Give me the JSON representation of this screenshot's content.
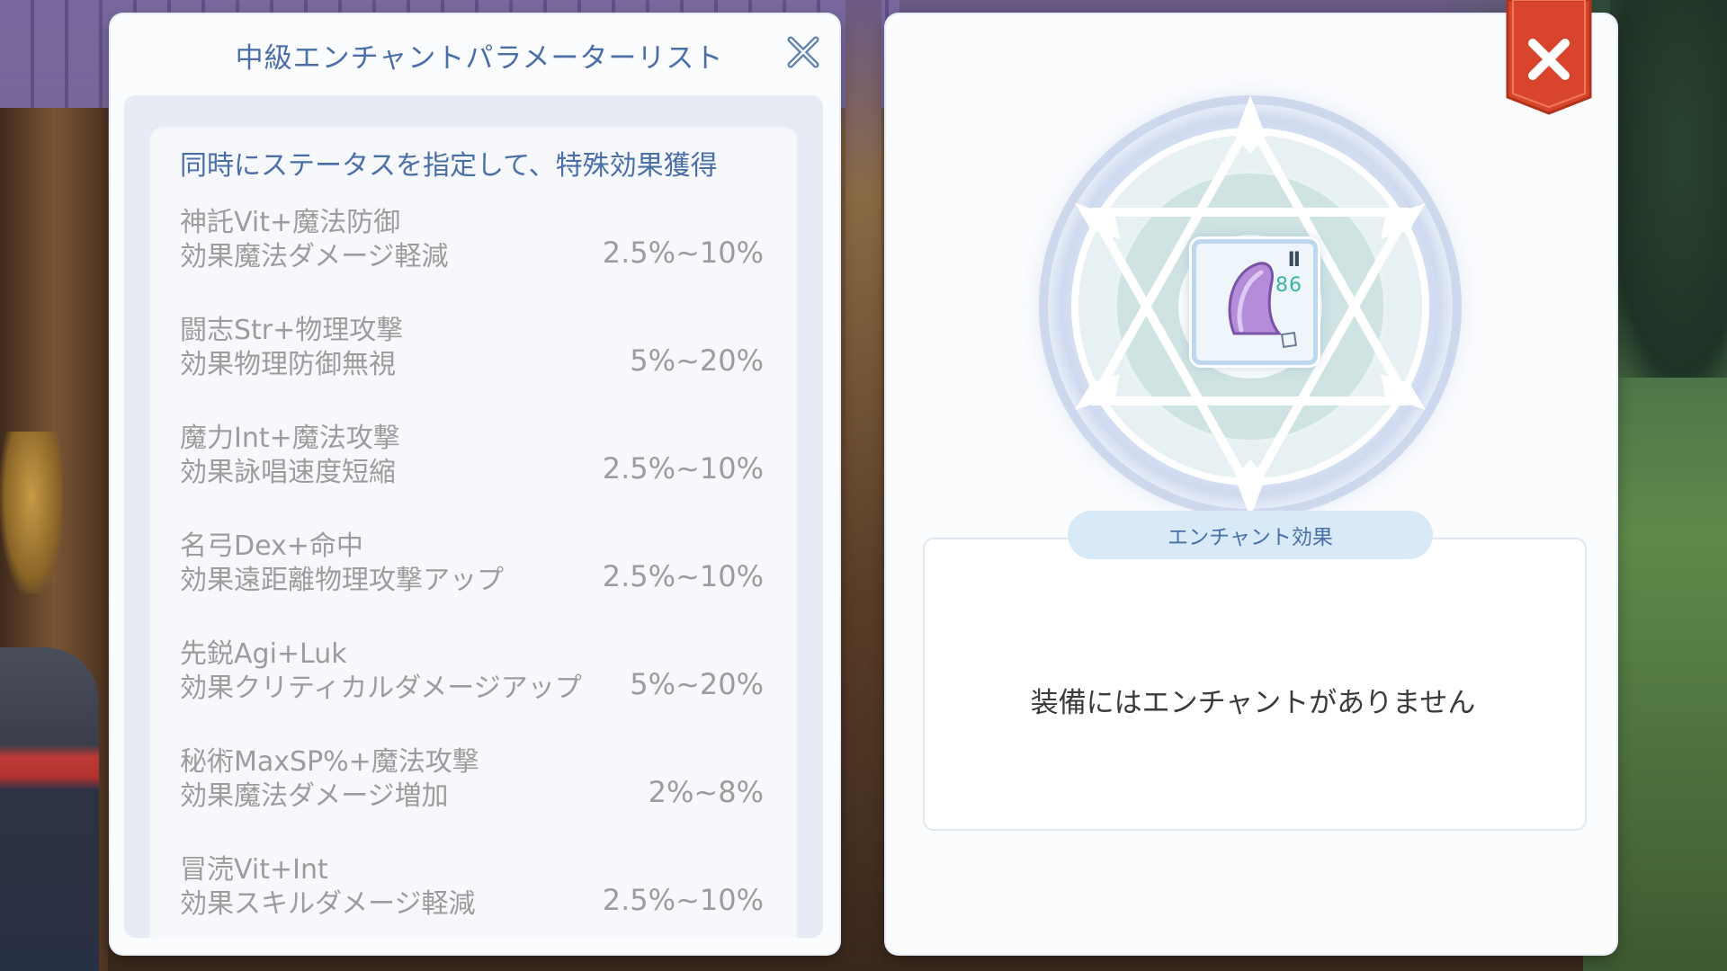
{
  "left_panel": {
    "title": "中級エンチャントパラメーターリスト",
    "heading": "同時にステータスを指定して、特殊効果獲得",
    "entries": [
      {
        "line1": "神託Vit+魔法防御",
        "line2": "効果魔法ダメージ軽減",
        "range": "2.5%~10%"
      },
      {
        "line1": "闘志Str+物理攻撃",
        "line2": "効果物理防御無視",
        "range": "5%~20%"
      },
      {
        "line1": "魔力Int+魔法攻撃",
        "line2": "効果詠唱速度短縮",
        "range": "2.5%~10%"
      },
      {
        "line1": "名弓Dex+命中",
        "line2": "効果遠距離物理攻撃アップ",
        "range": "2.5%~10%"
      },
      {
        "line1": "先鋭Agi+Luk",
        "line2": "効果クリティカルダメージアップ",
        "range": "5%~20%"
      },
      {
        "line1": "秘術MaxSP%+魔法攻撃",
        "line2": "効果魔法ダメージ増加",
        "range": "2%~8%"
      },
      {
        "line1": "冒涜Vit+Int",
        "line2": "効果スキルダメージ軽減",
        "range": "2.5%~10%"
      }
    ]
  },
  "right_panel": {
    "item_slot": {
      "tier": "II",
      "level": "86",
      "icon": "purple-hood-icon"
    },
    "effect_tab_label": "エンチャント効果",
    "effect_empty_text": "装備にはエンチャントがありません"
  },
  "icons": {
    "left_close": "close-x-icon",
    "ribbon_close": "red-ribbon-close-icon"
  },
  "colors": {
    "accent_blue": "#4a6fa8",
    "muted_gray": "#9c9c9c",
    "close_red": "#d8452c",
    "level_teal": "#3ab5a5"
  }
}
